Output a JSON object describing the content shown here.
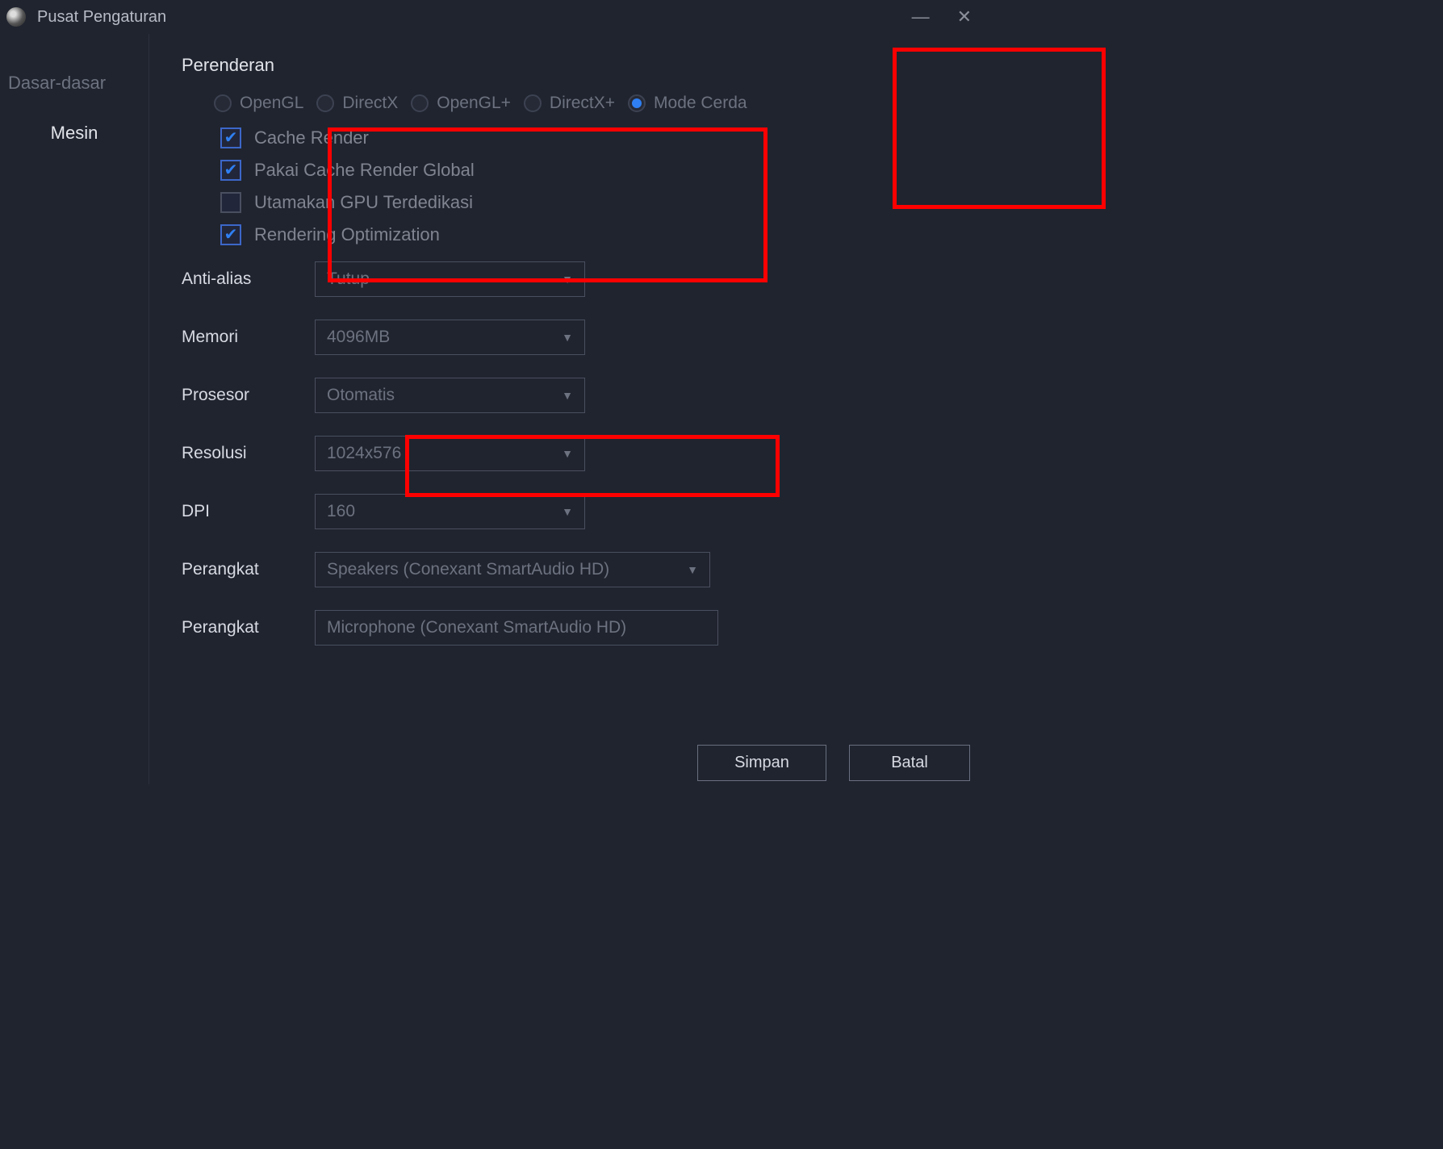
{
  "titlebar": {
    "title": "Pusat Pengaturan"
  },
  "sidebar": {
    "items": [
      {
        "label": "Dasar-dasar"
      },
      {
        "label": "Mesin"
      }
    ]
  },
  "section": {
    "title": "Perenderan"
  },
  "radios": {
    "opengl": "OpenGL",
    "directx": "DirectX",
    "openglplus": "OpenGL+",
    "directxplus": "DirectX+",
    "smart": "Mode Cerda"
  },
  "checks": {
    "cache": "Cache Render",
    "global_cache": "Pakai Cache Render Global",
    "gpu": "Utamakan GPU Terdedikasi",
    "opt": "Rendering Optimization"
  },
  "rows": {
    "antialias": {
      "label": "Anti-alias",
      "value": "Tutup"
    },
    "memory": {
      "label": "Memori",
      "value": "4096MB"
    },
    "processor": {
      "label": "Prosesor",
      "value": "Otomatis"
    },
    "resolution": {
      "label": "Resolusi",
      "value": "1024x576"
    },
    "dpi": {
      "label": "DPI",
      "value": "160"
    },
    "device1": {
      "label": "Perangkat",
      "value": "Speakers (Conexant SmartAudio HD)"
    },
    "device2": {
      "label": "Perangkat",
      "value": "Microphone (Conexant SmartAudio HD)"
    }
  },
  "buttons": {
    "save": "Simpan",
    "cancel": "Batal"
  }
}
